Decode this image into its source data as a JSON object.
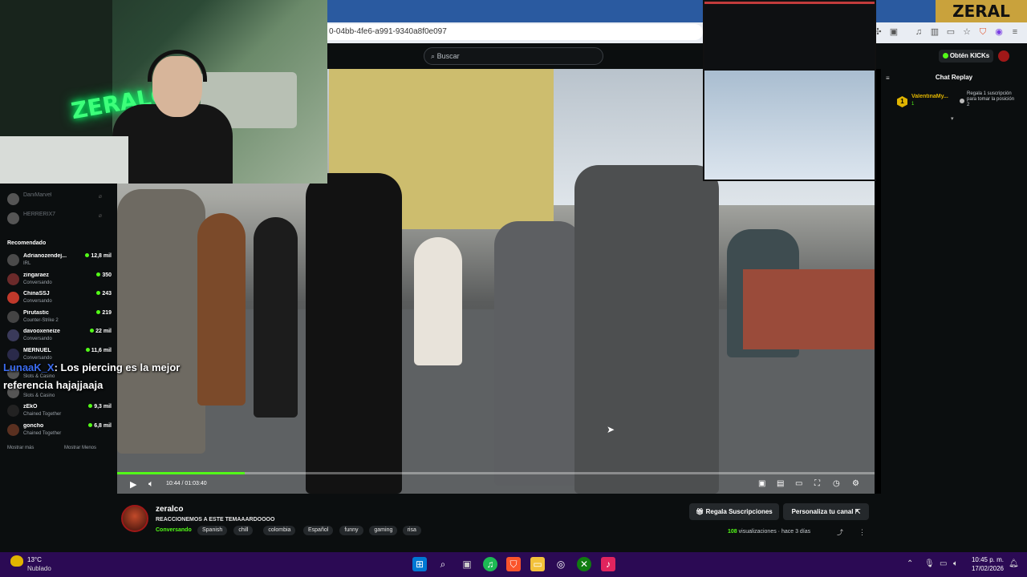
{
  "browser": {
    "url": "0-04bb-4fe6-a991-9340a8f0e097"
  },
  "header": {
    "search_placeholder": "Buscar",
    "kicks_button": "Obtén KICKs"
  },
  "overlay_logo": "ZERAL",
  "webcam_neon": "ZERALCO",
  "sidebar": {
    "following": [
      {
        "name": "DaniMarvel"
      },
      {
        "name": "HERRERIX7"
      }
    ],
    "recommended_title": "Recomendado",
    "recommended": [
      {
        "name": "Adrianozendej...",
        "category": "IRL",
        "viewers": "12,8 mil"
      },
      {
        "name": "zingaraez",
        "category": "Conversando",
        "viewers": "350"
      },
      {
        "name": "ChinaSSJ",
        "category": "Conversando",
        "viewers": "243"
      },
      {
        "name": "Pirutastic",
        "category": "Counter-Strike 2",
        "viewers": "219"
      },
      {
        "name": "davooxeneize",
        "category": "Conversando",
        "viewers": "22 mil"
      },
      {
        "name": "MERNUEL",
        "category": "Conversando",
        "viewers": "11,6 mil"
      },
      {
        "name": "",
        "category": "Slots & Casino",
        "viewers": ""
      },
      {
        "name": "",
        "category": "Slots & Casino",
        "viewers": ""
      },
      {
        "name": "zEkO",
        "category": "Chained Together",
        "viewers": "9,3 mil"
      },
      {
        "name": "goncho",
        "category": "Chained Together",
        "viewers": "6,8 mil"
      }
    ],
    "show_more": "Mostrar más",
    "show_less": "Mostrar Menos"
  },
  "chat_popup": {
    "user": "LunaaK_X",
    "message": ": Los piercing es la mejor referencia hajajjaaja"
  },
  "player": {
    "time": "10:44 / 01:03:40",
    "progress": 0.168
  },
  "chat": {
    "title": "Chat Replay",
    "gift_user": "ValentinaMy...",
    "gift_count": "1",
    "gift_rank": "1",
    "gift_text": "Regala 1 suscripción para tomar la posición 2"
  },
  "channel": {
    "name": "zeralco",
    "title": "REACCIONEMOS A ESTE TEMAAARDOOOO",
    "category": "Conversando",
    "tags": [
      "Spanish",
      "chill",
      "colombia",
      "Español",
      "funny",
      "gaming",
      "risa"
    ],
    "gift_button": "Regala Suscripciones",
    "customize_button": "Personaliza tu canal",
    "views_count": "108",
    "views_label": "visualizaciones",
    "age": "hace 3 días"
  },
  "taskbar": {
    "temp": "13°C",
    "weather": "Nublado",
    "time": "10:45 p. m.",
    "date": "17/02/2026"
  },
  "colors": {
    "accent": "#53fc18",
    "taskbar": "#2b0a54",
    "gift_gold": "#e0b400"
  }
}
